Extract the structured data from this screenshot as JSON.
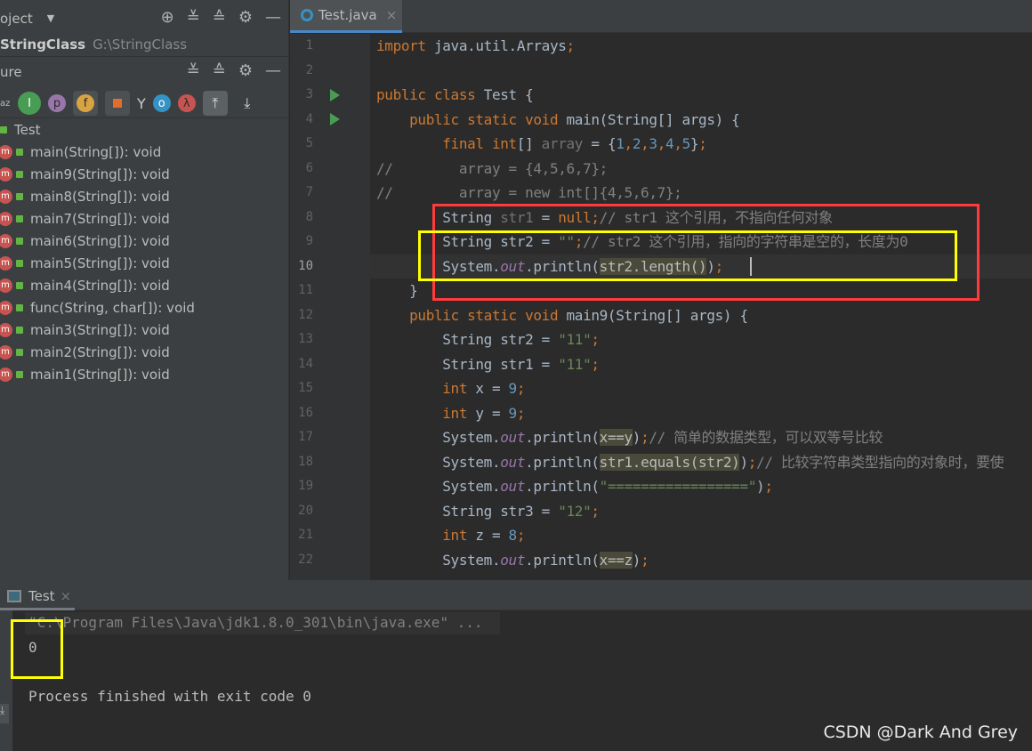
{
  "project_panel": {
    "title": "oject",
    "project_name": "StringClass",
    "project_path": "G:\\StringClass"
  },
  "structure_panel": {
    "title": "ure",
    "class_name": "Test",
    "members": [
      "main(String[]): void",
      "main9(String[]): void",
      "main8(String[]): void",
      "main7(String[]): void",
      "main6(String[]): void",
      "main5(String[]): void",
      "main4(String[]): void",
      "func(String, char[]): void",
      "main3(String[]): void",
      "main2(String[]): void",
      "main1(String[]): void"
    ]
  },
  "editor": {
    "tab_label": "Test.java",
    "current_line": 10,
    "lines": [
      [
        [
          "k",
          "import "
        ],
        [
          "d",
          "java.util.Arrays"
        ],
        [
          "k",
          ";"
        ]
      ],
      [],
      [
        [
          "k",
          "public class "
        ],
        [
          "d",
          "Test {"
        ]
      ],
      [
        [
          "d",
          "    "
        ],
        [
          "k",
          "public static void "
        ],
        [
          "d",
          "main(String[] args) {"
        ]
      ],
      [
        [
          "d",
          "        "
        ],
        [
          "k",
          "final int"
        ],
        [
          "d",
          "[] "
        ],
        [
          "g",
          "array"
        ],
        [
          "d",
          " = {"
        ],
        [
          "n",
          "1"
        ],
        [
          "k",
          ","
        ],
        [
          "n",
          "2"
        ],
        [
          "k",
          ","
        ],
        [
          "n",
          "3"
        ],
        [
          "k",
          ","
        ],
        [
          "n",
          "4"
        ],
        [
          "k",
          ","
        ],
        [
          "n",
          "5"
        ],
        [
          "d",
          "}"
        ],
        [
          "k",
          ";"
        ]
      ],
      [
        [
          "c",
          "//        array = {4,5,6,7};"
        ]
      ],
      [
        [
          "c",
          "//        array = new int[]{4,5,6,7};"
        ]
      ],
      [
        [
          "d",
          "        String "
        ],
        [
          "g",
          "str1"
        ],
        [
          "d",
          " = "
        ],
        [
          "k",
          "null;"
        ],
        [
          "c",
          "// str1 这个引用，不指向任何对象"
        ]
      ],
      [
        [
          "d",
          "        String str2 = "
        ],
        [
          "s",
          "\"\""
        ],
        [
          "k",
          ";"
        ],
        [
          "c",
          "// str2 这个引用，指向的字符串是空的，长度为0"
        ]
      ],
      [
        [
          "d",
          "        System."
        ],
        [
          "f",
          "out"
        ],
        [
          "d",
          ".println("
        ],
        [
          "hl",
          "str2.length()"
        ],
        [
          "d",
          ")"
        ],
        [
          "k",
          ";"
        ]
      ],
      [
        [
          "d",
          "    }"
        ]
      ],
      [
        [
          "d",
          "    "
        ],
        [
          "k",
          "public static void "
        ],
        [
          "d",
          "main9(String[] args) {"
        ]
      ],
      [
        [
          "d",
          "        String str2 = "
        ],
        [
          "s",
          "\"11\""
        ],
        [
          "k",
          ";"
        ]
      ],
      [
        [
          "d",
          "        String str1 = "
        ],
        [
          "s",
          "\"11\""
        ],
        [
          "k",
          ";"
        ]
      ],
      [
        [
          "d",
          "        "
        ],
        [
          "k",
          "int "
        ],
        [
          "d",
          "x = "
        ],
        [
          "n",
          "9"
        ],
        [
          "k",
          ";"
        ]
      ],
      [
        [
          "d",
          "        "
        ],
        [
          "k",
          "int "
        ],
        [
          "d",
          "y = "
        ],
        [
          "n",
          "9"
        ],
        [
          "k",
          ";"
        ]
      ],
      [
        [
          "d",
          "        System."
        ],
        [
          "f",
          "out"
        ],
        [
          "d",
          ".println("
        ],
        [
          "hl",
          "x==y"
        ],
        [
          "d",
          ")"
        ],
        [
          "k",
          ";"
        ],
        [
          "c",
          "// 简单的数据类型，可以双等号比较"
        ]
      ],
      [
        [
          "d",
          "        System."
        ],
        [
          "f",
          "out"
        ],
        [
          "d",
          ".println("
        ],
        [
          "hl",
          "str1.equals(str2)"
        ],
        [
          "d",
          ")"
        ],
        [
          "k",
          ";"
        ],
        [
          "c",
          "// 比较字符串类型指向的对象时，要使"
        ]
      ],
      [
        [
          "d",
          "        System."
        ],
        [
          "f",
          "out"
        ],
        [
          "d",
          ".println("
        ],
        [
          "s",
          "\"=================\""
        ],
        [
          "d",
          ")"
        ],
        [
          "k",
          ";"
        ]
      ],
      [
        [
          "d",
          "        String str3 = "
        ],
        [
          "s",
          "\"12\""
        ],
        [
          "k",
          ";"
        ]
      ],
      [
        [
          "d",
          "        "
        ],
        [
          "k",
          "int "
        ],
        [
          "d",
          "z = "
        ],
        [
          "n",
          "8"
        ],
        [
          "k",
          ";"
        ]
      ],
      [
        [
          "d",
          "        System."
        ],
        [
          "f",
          "out"
        ],
        [
          "d",
          ".println("
        ],
        [
          "hl",
          "x==z"
        ],
        [
          "d",
          ")"
        ],
        [
          "k",
          ";"
        ]
      ]
    ]
  },
  "run_panel": {
    "tab_label": "Test",
    "command": "\"C:\\Program Files\\Java\\jdk1.8.0_301\\bin\\java.exe\" ...",
    "output": "0",
    "exit_message": "Process finished with exit code 0"
  },
  "watermark": "CSDN @Dark And Grey",
  "colors": {
    "red_box": "#ff3b3b",
    "yellow_box": "#ffff00"
  }
}
